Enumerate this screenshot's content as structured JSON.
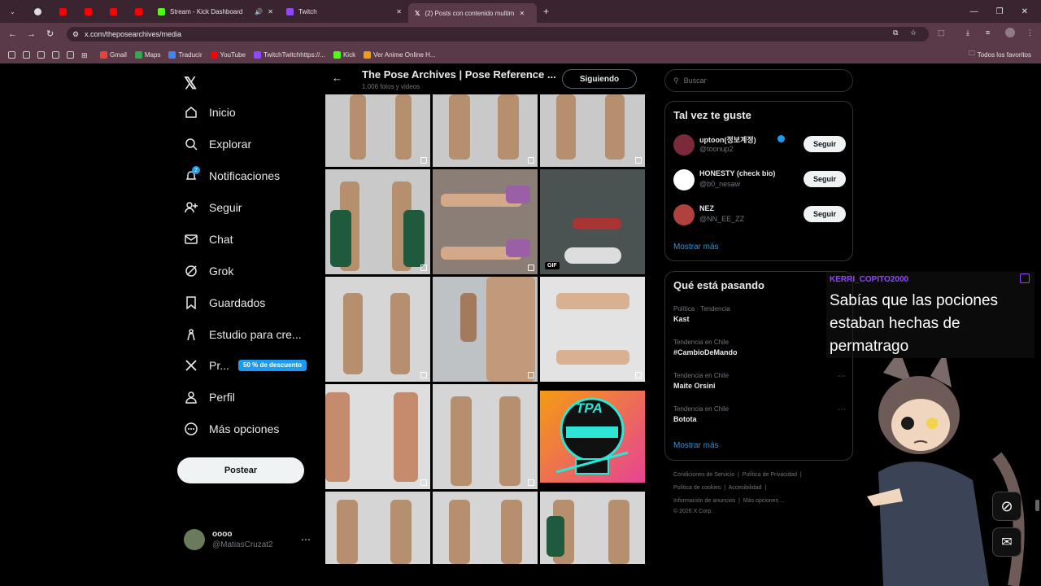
{
  "browser": {
    "tabs": [
      {
        "label": "Stream - Kick Dashboard"
      },
      {
        "label": "Twitch"
      },
      {
        "label": "(2) Posts con contenido multim"
      }
    ],
    "url": "x.com/theposearchives/media",
    "bookmarks": [
      "Gmail",
      "Maps",
      "Traducir",
      "YouTube",
      "TwitchTwitchhttps://...",
      "Kick",
      "Ver Anime Online H..."
    ],
    "all_bookmarks": "Todos los favoritos"
  },
  "nav": {
    "items": [
      "Inicio",
      "Explorar",
      "Notificaciones",
      "Seguir",
      "Chat",
      "Grok",
      "Guardados",
      "Estudio para cre...",
      "Pr...",
      "Perfil",
      "Más opciones"
    ],
    "notif_badge": "2",
    "premium_badge": "50 % de descuento",
    "post_button": "Postear",
    "account_name": "oooo",
    "account_handle": "@MatiasCruzat2"
  },
  "header": {
    "title": "The Pose Archives | Pose Reference ...",
    "subtitle": "1.006 fotos y videos",
    "follow_state": "Siguiendo"
  },
  "media": {
    "gif_label": "GIF",
    "tpa_label": "TPA"
  },
  "search": {
    "placeholder": "Buscar"
  },
  "suggestions": {
    "title": "Tal vez te guste",
    "users": [
      {
        "name": "uptoon(정보계정)",
        "handle": "@toonup2",
        "button": "Seguir"
      },
      {
        "name": "HONESTY (check bio)",
        "handle": "@b0_nesaw",
        "button": "Seguir"
      },
      {
        "name": "NEZ",
        "handle": "@NN_EE_ZZ",
        "button": "Seguir"
      }
    ],
    "more": "Mostrar más"
  },
  "trends": {
    "title": "Qué está pasando",
    "items": [
      {
        "context": "Política · Tendencia",
        "topic": "Kast"
      },
      {
        "context": "Tendencia en Chile",
        "topic": "#CambioDeMando"
      },
      {
        "context": "Tendencia en Chile",
        "topic": "Maite Orsini"
      },
      {
        "context": "Tendencia en Chile",
        "topic": "Botota"
      }
    ],
    "more": "Mostrar más"
  },
  "footer": {
    "links": [
      "Condiciones de Servicio",
      "Política de Privacidad",
      "Política de cookies",
      "Accesibilidad",
      "Información de anuncios",
      "Más opciones ..."
    ],
    "copyright": "© 2026 X Corp."
  },
  "overlay": {
    "chat_user": "KERRI_COPITO2000",
    "chat_message": "Sabías que las pociones estaban hechas de permatrago",
    "chat_user_color": "#9147ff"
  }
}
